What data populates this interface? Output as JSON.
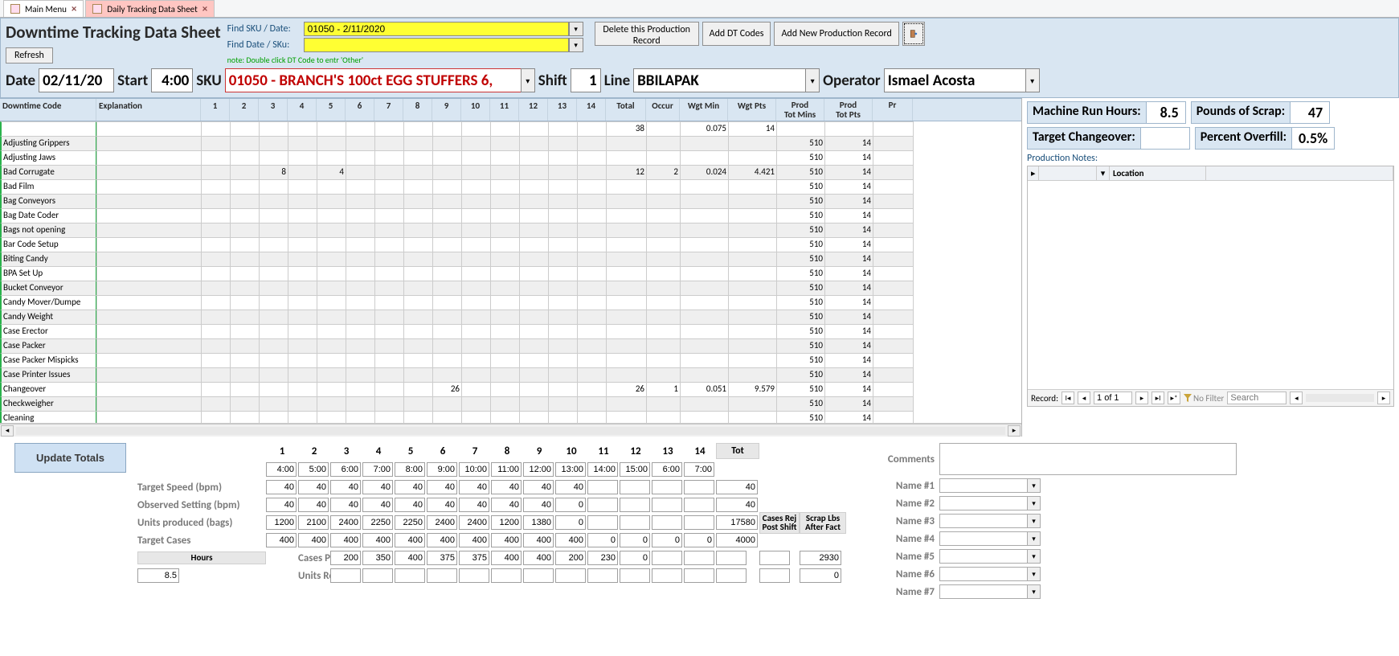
{
  "tabs": [
    {
      "label": "Main Menu",
      "active": false
    },
    {
      "label": "Daily Tracking Data Sheet",
      "active": true
    }
  ],
  "title": "Downtime Tracking Data Sheet",
  "btn_refresh": "Refresh",
  "find": {
    "sku_date_lbl": "Find SKU / Date:",
    "sku_date_val": "01050 - 2/11/2020",
    "date_sku_lbl": "Find Date / SKu:",
    "date_sku_val": "",
    "note": "note: Double click DT Code to entr 'Other'"
  },
  "hdr_buttons": {
    "delete": "Delete this Production Record",
    "add_dt": "Add DT Codes",
    "add_new": "Add New Production Record"
  },
  "record": {
    "date_lbl": "Date",
    "date_val": "02/11/20",
    "start_lbl": "Start",
    "start_val": "4:00",
    "sku_lbl": "SKU",
    "sku_val": "01050 - BRANCH'S 100ct EGG STUFFERS 6,",
    "shift_lbl": "Shift",
    "shift_val": "1",
    "line_lbl": "Line",
    "line_val": "BBILAPAK",
    "operator_lbl": "Operator",
    "operator_val": "Ismael Acosta"
  },
  "grid": {
    "headers": [
      "Downtime Code",
      "Explanation",
      "1",
      "2",
      "3",
      "4",
      "5",
      "6",
      "7",
      "8",
      "9",
      "10",
      "11",
      "12",
      "13",
      "14",
      "Total",
      "Occur",
      "Wgt Min",
      "Wgt Pts",
      "Prod Tot Mins",
      "Prod Tot Pts",
      "Pr"
    ],
    "rows": [
      {
        "code": "",
        "expl": "",
        "cells": [
          "",
          "",
          "",
          "",
          "",
          "",
          "",
          "",
          "",
          "",
          "",
          "",
          "",
          ""
        ],
        "total": "38",
        "occur": "",
        "wgtmin": "0.075",
        "wgtpts": "14",
        "prodmin": "",
        "prodpts": ""
      },
      {
        "code": "Adjusting Grippers",
        "expl": "",
        "cells": [
          "",
          "",
          "",
          "",
          "",
          "",
          "",
          "",
          "",
          "",
          "",
          "",
          "",
          ""
        ],
        "total": "",
        "occur": "",
        "wgtmin": "",
        "wgtpts": "",
        "prodmin": "510",
        "prodpts": "14"
      },
      {
        "code": "Adjusting Jaws",
        "expl": "",
        "cells": [
          "",
          "",
          "",
          "",
          "",
          "",
          "",
          "",
          "",
          "",
          "",
          "",
          "",
          ""
        ],
        "total": "",
        "occur": "",
        "wgtmin": "",
        "wgtpts": "",
        "prodmin": "510",
        "prodpts": "14"
      },
      {
        "code": "Bad Corrugate",
        "expl": "",
        "cells": [
          "",
          "",
          "8",
          "",
          "4",
          "",
          "",
          "",
          "",
          "",
          "",
          "",
          "",
          ""
        ],
        "total": "12",
        "occur": "2",
        "wgtmin": "0.024",
        "wgtpts": "4.421",
        "prodmin": "510",
        "prodpts": "14"
      },
      {
        "code": "Bad Film",
        "expl": "",
        "cells": [
          "",
          "",
          "",
          "",
          "",
          "",
          "",
          "",
          "",
          "",
          "",
          "",
          "",
          ""
        ],
        "total": "",
        "occur": "",
        "wgtmin": "",
        "wgtpts": "",
        "prodmin": "510",
        "prodpts": "14"
      },
      {
        "code": "Bag Conveyors",
        "expl": "",
        "cells": [
          "",
          "",
          "",
          "",
          "",
          "",
          "",
          "",
          "",
          "",
          "",
          "",
          "",
          ""
        ],
        "total": "",
        "occur": "",
        "wgtmin": "",
        "wgtpts": "",
        "prodmin": "510",
        "prodpts": "14"
      },
      {
        "code": "Bag Date Coder",
        "expl": "",
        "cells": [
          "",
          "",
          "",
          "",
          "",
          "",
          "",
          "",
          "",
          "",
          "",
          "",
          "",
          ""
        ],
        "total": "",
        "occur": "",
        "wgtmin": "",
        "wgtpts": "",
        "prodmin": "510",
        "prodpts": "14"
      },
      {
        "code": "Bags not opening",
        "expl": "",
        "cells": [
          "",
          "",
          "",
          "",
          "",
          "",
          "",
          "",
          "",
          "",
          "",
          "",
          "",
          ""
        ],
        "total": "",
        "occur": "",
        "wgtmin": "",
        "wgtpts": "",
        "prodmin": "510",
        "prodpts": "14"
      },
      {
        "code": "Bar Code Setup",
        "expl": "",
        "cells": [
          "",
          "",
          "",
          "",
          "",
          "",
          "",
          "",
          "",
          "",
          "",
          "",
          "",
          ""
        ],
        "total": "",
        "occur": "",
        "wgtmin": "",
        "wgtpts": "",
        "prodmin": "510",
        "prodpts": "14"
      },
      {
        "code": "Biting Candy",
        "expl": "",
        "cells": [
          "",
          "",
          "",
          "",
          "",
          "",
          "",
          "",
          "",
          "",
          "",
          "",
          "",
          ""
        ],
        "total": "",
        "occur": "",
        "wgtmin": "",
        "wgtpts": "",
        "prodmin": "510",
        "prodpts": "14"
      },
      {
        "code": "BPA Set Up",
        "expl": "",
        "cells": [
          "",
          "",
          "",
          "",
          "",
          "",
          "",
          "",
          "",
          "",
          "",
          "",
          "",
          ""
        ],
        "total": "",
        "occur": "",
        "wgtmin": "",
        "wgtpts": "",
        "prodmin": "510",
        "prodpts": "14"
      },
      {
        "code": "Bucket Conveyor",
        "expl": "",
        "cells": [
          "",
          "",
          "",
          "",
          "",
          "",
          "",
          "",
          "",
          "",
          "",
          "",
          "",
          ""
        ],
        "total": "",
        "occur": "",
        "wgtmin": "",
        "wgtpts": "",
        "prodmin": "510",
        "prodpts": "14"
      },
      {
        "code": "Candy Mover/Dumpe",
        "expl": "",
        "cells": [
          "",
          "",
          "",
          "",
          "",
          "",
          "",
          "",
          "",
          "",
          "",
          "",
          "",
          ""
        ],
        "total": "",
        "occur": "",
        "wgtmin": "",
        "wgtpts": "",
        "prodmin": "510",
        "prodpts": "14"
      },
      {
        "code": "Candy Weight",
        "expl": "",
        "cells": [
          "",
          "",
          "",
          "",
          "",
          "",
          "",
          "",
          "",
          "",
          "",
          "",
          "",
          ""
        ],
        "total": "",
        "occur": "",
        "wgtmin": "",
        "wgtpts": "",
        "prodmin": "510",
        "prodpts": "14"
      },
      {
        "code": "Case Erector",
        "expl": "",
        "cells": [
          "",
          "",
          "",
          "",
          "",
          "",
          "",
          "",
          "",
          "",
          "",
          "",
          "",
          ""
        ],
        "total": "",
        "occur": "",
        "wgtmin": "",
        "wgtpts": "",
        "prodmin": "510",
        "prodpts": "14"
      },
      {
        "code": "Case Packer",
        "expl": "",
        "cells": [
          "",
          "",
          "",
          "",
          "",
          "",
          "",
          "",
          "",
          "",
          "",
          "",
          "",
          ""
        ],
        "total": "",
        "occur": "",
        "wgtmin": "",
        "wgtpts": "",
        "prodmin": "510",
        "prodpts": "14"
      },
      {
        "code": "Case Packer Mispicks",
        "expl": "",
        "cells": [
          "",
          "",
          "",
          "",
          "",
          "",
          "",
          "",
          "",
          "",
          "",
          "",
          "",
          ""
        ],
        "total": "",
        "occur": "",
        "wgtmin": "",
        "wgtpts": "",
        "prodmin": "510",
        "prodpts": "14"
      },
      {
        "code": "Case Printer Issues",
        "expl": "",
        "cells": [
          "",
          "",
          "",
          "",
          "",
          "",
          "",
          "",
          "",
          "",
          "",
          "",
          "",
          ""
        ],
        "total": "",
        "occur": "",
        "wgtmin": "",
        "wgtpts": "",
        "prodmin": "510",
        "prodpts": "14"
      },
      {
        "code": "Changeover",
        "expl": "",
        "cells": [
          "",
          "",
          "",
          "",
          "",
          "",
          "",
          "",
          "26",
          "",
          "",
          "",
          "",
          ""
        ],
        "total": "26",
        "occur": "1",
        "wgtmin": "0.051",
        "wgtpts": "9.579",
        "prodmin": "510",
        "prodpts": "14"
      },
      {
        "code": "Checkweigher",
        "expl": "",
        "cells": [
          "",
          "",
          "",
          "",
          "",
          "",
          "",
          "",
          "",
          "",
          "",
          "",
          "",
          ""
        ],
        "total": "",
        "occur": "",
        "wgtmin": "",
        "wgtpts": "",
        "prodmin": "510",
        "prodpts": "14"
      },
      {
        "code": "Cleaning",
        "expl": "",
        "cells": [
          "",
          "",
          "",
          "",
          "",
          "",
          "",
          "",
          "",
          "",
          "",
          "",
          "",
          ""
        ],
        "total": "",
        "occur": "",
        "wgtmin": "",
        "wgtpts": "",
        "prodmin": "510",
        "prodpts": "14"
      }
    ]
  },
  "right": {
    "machine_hours_lbl": "Machine Run Hours:",
    "machine_hours_val": "8.5",
    "scrap_lbl": "Pounds of Scrap:",
    "scrap_val": "47",
    "changeover_lbl": "Target Changeover:",
    "changeover_val": "",
    "overfill_lbl": "Percent Overfill:",
    "overfill_val": "0.5%",
    "notes_lbl": "Production Notes:",
    "loc_head": "Location",
    "rec_nav": {
      "label": "Record:",
      "pos": "1 of 1",
      "filter": "No Filter",
      "search": "Search"
    }
  },
  "totals": {
    "btn_update": "Update Totals",
    "col_heads": [
      "1",
      "2",
      "3",
      "4",
      "5",
      "6",
      "7",
      "8",
      "9",
      "10",
      "11",
      "12",
      "13",
      "14"
    ],
    "tot_head": "Tot",
    "hours_head": "Hours",
    "cases_head": "Cases Rej Post Shift",
    "scrap_head": "Scrap Lbs After Fact",
    "times": [
      "4:00",
      "5:00",
      "6:00",
      "7:00",
      "8:00",
      "9:00",
      "10:00",
      "11:00",
      "12:00",
      "13:00",
      "14:00",
      "15:00",
      "6:00",
      "7:00"
    ],
    "rows": [
      {
        "label": "Target Speed (bpm)",
        "vals": [
          "40",
          "40",
          "40",
          "40",
          "40",
          "40",
          "40",
          "40",
          "40",
          "40",
          "",
          "",
          "",
          ""
        ],
        "tot": "40"
      },
      {
        "label": "Observed Setting (bpm)",
        "vals": [
          "40",
          "40",
          "40",
          "40",
          "40",
          "40",
          "40",
          "40",
          "40",
          "0",
          "",
          "",
          "",
          ""
        ],
        "tot": "40"
      },
      {
        "label": "Units produced (bags)",
        "vals": [
          "1200",
          "2100",
          "2400",
          "2250",
          "2250",
          "2400",
          "2400",
          "1200",
          "1380",
          "0",
          "",
          "",
          "",
          ""
        ],
        "tot": "17580"
      },
      {
        "label": "Target Cases",
        "vals": [
          "400",
          "400",
          "400",
          "400",
          "400",
          "400",
          "400",
          "400",
          "400",
          "400",
          "0",
          "0",
          "0",
          "0"
        ],
        "tot": "4000"
      },
      {
        "label": "Cases Packed",
        "vals": [
          "200",
          "350",
          "400",
          "375",
          "375",
          "400",
          "400",
          "200",
          "230",
          "0",
          "",
          "",
          "",
          ""
        ],
        "tot": "2930",
        "hours": "8.5"
      },
      {
        "label": "Units Rejected",
        "vals": [
          "",
          "",
          "",
          "",
          "",
          "",
          "",
          "",
          "",
          "",
          "",
          "",
          "",
          ""
        ],
        "tot": "0"
      }
    ]
  },
  "comments": {
    "comments_lbl": "Comments",
    "comments_val": "",
    "names": [
      "Name #1",
      "Name #2",
      "Name #3",
      "Name #4",
      "Name #5",
      "Name #6",
      "Name #7"
    ]
  }
}
